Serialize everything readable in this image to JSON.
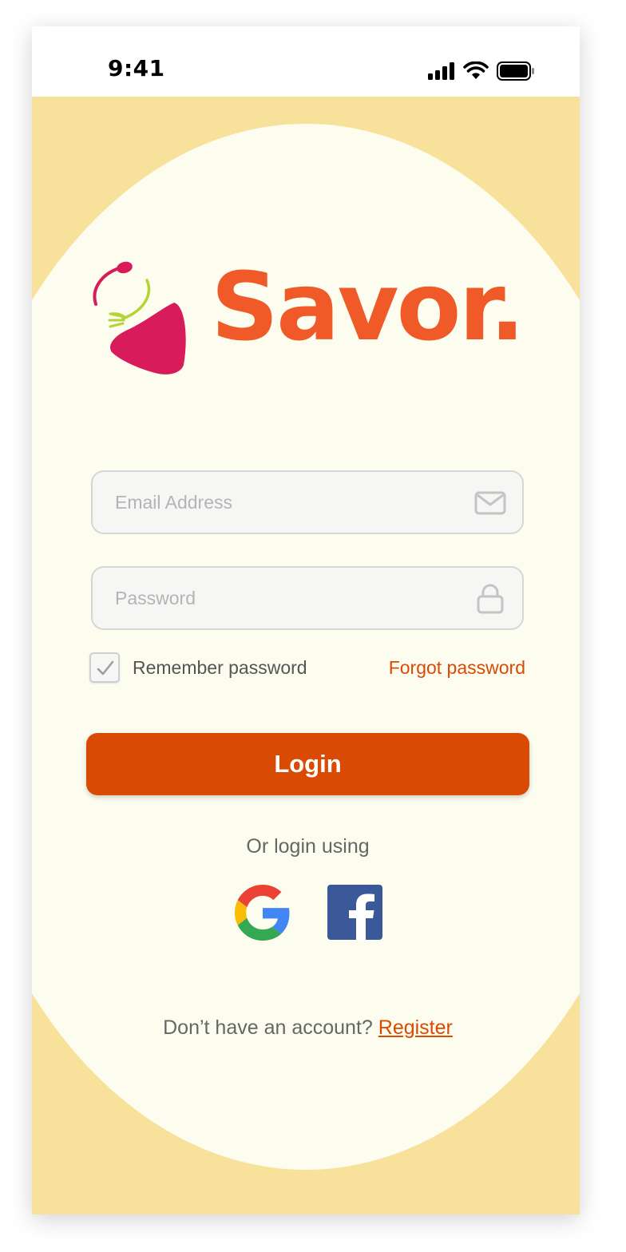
{
  "status_bar": {
    "time": "9:41",
    "icons": [
      "cellular-signal-icon",
      "wifi-icon",
      "battery-icon"
    ]
  },
  "brand": {
    "name": "Savor.",
    "logo_icon": "bowl-with-spoon-and-fork-logo",
    "text_color": "#f05a28",
    "bowl_color": "#d81b5a",
    "fork_color": "#b5d334"
  },
  "login_form": {
    "email": {
      "placeholder": "Email Address",
      "value": "",
      "icon": "envelope-icon"
    },
    "password": {
      "placeholder": "Password",
      "value": "",
      "icon": "lock-icon"
    },
    "remember": {
      "label": "Remember password",
      "checked": true
    },
    "forgot_label": "Forgot password",
    "login_label": "Login"
  },
  "social": {
    "prompt": "Or login using",
    "providers": [
      {
        "name": "Google",
        "icon": "google-icon"
      },
      {
        "name": "Facebook",
        "icon": "facebook-icon"
      }
    ]
  },
  "signup": {
    "prompt": "Don’t have an account?",
    "link_label": "Register"
  },
  "colors": {
    "accent": "#d94a04",
    "background": "#f8e19a",
    "card": "#fdfdef",
    "facebook": "#3b5998"
  }
}
